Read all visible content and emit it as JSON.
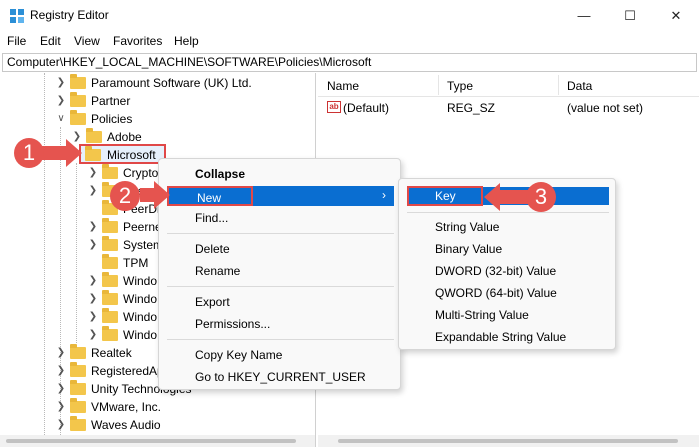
{
  "window": {
    "title": "Registry Editor"
  },
  "menu": [
    "File",
    "Edit",
    "View",
    "Favorites",
    "Help"
  ],
  "address": "Computer\\HKEY_LOCAL_MACHINE\\SOFTWARE\\Policies\\Microsoft",
  "tree": {
    "items": [
      "Paramount Software (UK) Ltd.",
      "Partner",
      "Policies",
      "Adobe",
      "Microsoft",
      "Crypto",
      "Peer",
      "PeerDi",
      "Peerne",
      "System",
      "TPM",
      "Windo",
      "Windo",
      "Windo",
      "Windo",
      "Realtek",
      "RegisteredAp",
      "Unity Technologies",
      "VMware, Inc.",
      "Waves Audio"
    ]
  },
  "list": {
    "headers": [
      "Name",
      "Type",
      "Data"
    ],
    "rows": [
      {
        "name": "(Default)",
        "type": "REG_SZ",
        "data": "(value not set)",
        "icon": "ab"
      }
    ]
  },
  "context_menu": {
    "items": [
      "Collapse",
      "New",
      "Find...",
      "Delete",
      "Rename",
      "Export",
      "Permissions...",
      "Copy Key Name",
      "Go to HKEY_CURRENT_USER"
    ],
    "chevron": "›"
  },
  "submenu": {
    "items": [
      "Key",
      "String Value",
      "Binary Value",
      "DWORD (32-bit) Value",
      "QWORD (64-bit) Value",
      "Multi-String Value",
      "Expandable String Value"
    ]
  },
  "callouts": [
    "1",
    "2",
    "3"
  ],
  "colors": {
    "highlight": "#0a6ed1",
    "annotation_red": "#e04848",
    "folder": "#f3c64b"
  }
}
